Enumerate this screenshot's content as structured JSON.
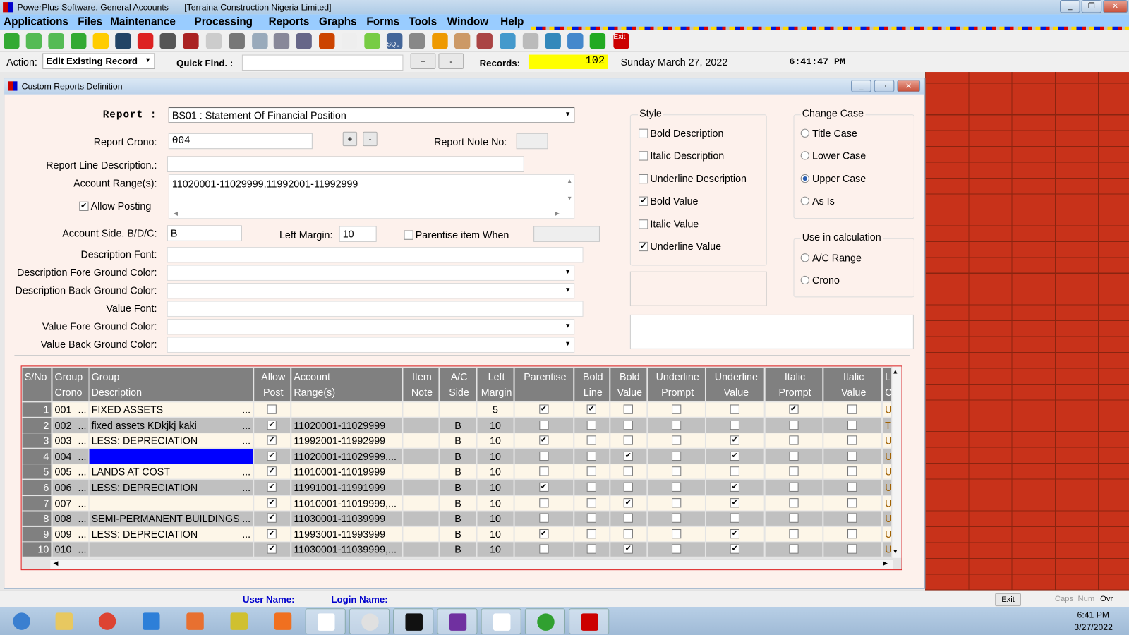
{
  "app": {
    "title": "PowerPlus-Software. General Accounts",
    "company": "[Terraina Construction Nigeria Limited]"
  },
  "menu": [
    "Applications",
    "Files",
    "Maintenance",
    "Processing",
    "Reports",
    "Graphs",
    "Forms",
    "Tools",
    "Window",
    "Help"
  ],
  "toolbar": {
    "icons": [
      "up-arrow-icon",
      "left-arrow-icon",
      "right-arrow-icon",
      "down-arrow-icon",
      "new-icon",
      "save-icon",
      "delete-icon",
      "brush-icon",
      "cancel-icon",
      "database-icon",
      "print-icon",
      "fax-icon",
      "calculator-icon",
      "calendar-icon",
      "briefcase-icon",
      "document-icon",
      "phone-icon",
      "sql-icon",
      "chip-icon",
      "settings-icon",
      "users-icon",
      "presenter-icon",
      "info-icon",
      "disk-icon",
      "globe-icon",
      "globe2-icon",
      "help-icon",
      "exit-icon"
    ],
    "exit_label": "Exit",
    "sql_label": "SQL"
  },
  "actionbar": {
    "action_label": "Action:",
    "action_value": "Edit Existing Record",
    "quickfind_label": "Quick Find. :",
    "quickfind_value": "",
    "plus": "+",
    "minus": "-",
    "records_label": "Records:",
    "records_value": "102",
    "date": "Sunday March  27,  2022",
    "time": "6:41:47 PM"
  },
  "window": {
    "title": "Custom Reports Definition"
  },
  "form": {
    "report_label": "Report :",
    "report_value": "BS01 : Statement Of Financial Position",
    "crono_label": "Report Crono:",
    "crono_value": "004",
    "plus": "+",
    "minus": "-",
    "note_label": "Report Note No:",
    "note_value": "",
    "line_desc_label": "Report Line Description.:",
    "line_desc_value": "",
    "range_label": "Account Range(s):",
    "range_value": "11020001-11029999,11992001-11992999",
    "allow_posting_label": "Allow Posting",
    "allow_posting": true,
    "side_label": "Account Side. B/D/C:",
    "side_value": "B",
    "margin_label": "Left Margin:",
    "margin_value": "10",
    "parentise_label": "Parentise item When",
    "parentise": false,
    "parentise_value": "",
    "desc_font_label": "Description Font:",
    "desc_fg_label": "Description Fore Ground Color:",
    "desc_bg_label": "Description Back Ground Color:",
    "value_font_label": "Value Font:",
    "value_fg_label": "Value Fore Ground Color:",
    "value_bg_label": "Value Back Ground Color:"
  },
  "style": {
    "title": "Style",
    "items": [
      {
        "label": "Bold Description",
        "checked": false
      },
      {
        "label": "Italic Description",
        "checked": false
      },
      {
        "label": "Underline Description",
        "checked": false
      },
      {
        "label": "Bold Value",
        "checked": true
      },
      {
        "label": "Italic Value",
        "checked": false
      },
      {
        "label": "Underline Value",
        "checked": true
      }
    ]
  },
  "change_case": {
    "title": "Change Case",
    "items": [
      {
        "label": "Title Case",
        "selected": false
      },
      {
        "label": "Lower Case",
        "selected": false
      },
      {
        "label": "Upper Case",
        "selected": true
      },
      {
        "label": "As Is",
        "selected": false
      }
    ]
  },
  "calc": {
    "title": "Use in calculation",
    "items": [
      {
        "label": "A/C Range",
        "selected": false
      },
      {
        "label": "Crono",
        "selected": false
      }
    ]
  },
  "grid": {
    "headers": [
      [
        "S/No",
        ""
      ],
      [
        "Group",
        "Crono"
      ],
      [
        "Group",
        "Description"
      ],
      [
        "Allow",
        "Post"
      ],
      [
        "Account",
        "Range(s)"
      ],
      [
        "Item",
        "Note"
      ],
      [
        "A/C",
        "Side"
      ],
      [
        "Left",
        "Margin"
      ],
      [
        "Parentise",
        ""
      ],
      [
        "Bold",
        "Line"
      ],
      [
        "Bold",
        "Value"
      ],
      [
        "Underline",
        "Prompt"
      ],
      [
        "Underline",
        "Value"
      ],
      [
        "Italic",
        "Prompt"
      ],
      [
        "Italic",
        "Value"
      ],
      [
        "L",
        "C"
      ]
    ],
    "rows": [
      {
        "sno": "1",
        "crono": "001",
        "desc": "FIXED ASSETS",
        "allow": false,
        "range": "",
        "note": "",
        "side": "",
        "margin": "5",
        "par": true,
        "bl": true,
        "bv": false,
        "up": false,
        "uv": false,
        "ip": true,
        "iv": false,
        "last": "U"
      },
      {
        "sno": "2",
        "crono": "002",
        "desc": "fixed assets  KDkjkj  kaki",
        "allow": true,
        "range": "11020001-11029999",
        "note": "",
        "side": "B",
        "margin": "10",
        "par": false,
        "bl": false,
        "bv": false,
        "up": false,
        "uv": false,
        "ip": false,
        "iv": false,
        "last": "T"
      },
      {
        "sno": "3",
        "crono": "003",
        "desc": "LESS: DEPRECIATION",
        "allow": true,
        "range": "11992001-11992999",
        "note": "",
        "side": "B",
        "margin": "10",
        "par": true,
        "bl": false,
        "bv": false,
        "up": false,
        "uv": true,
        "ip": false,
        "iv": false,
        "last": "U"
      },
      {
        "sno": "4",
        "crono": "004",
        "desc": "",
        "allow": true,
        "range": "11020001-11029999,...",
        "note": "",
        "side": "B",
        "margin": "10",
        "par": false,
        "bl": false,
        "bv": true,
        "up": false,
        "uv": true,
        "ip": false,
        "iv": false,
        "last": "U",
        "selected": true
      },
      {
        "sno": "5",
        "crono": "005",
        "desc": "LANDS AT COST",
        "allow": true,
        "range": "11010001-11019999",
        "note": "",
        "side": "B",
        "margin": "10",
        "par": false,
        "bl": false,
        "bv": false,
        "up": false,
        "uv": false,
        "ip": false,
        "iv": false,
        "last": "U"
      },
      {
        "sno": "6",
        "crono": "006",
        "desc": "LESS: DEPRECIATION",
        "allow": true,
        "range": "11991001-11991999",
        "note": "",
        "side": "B",
        "margin": "10",
        "par": true,
        "bl": false,
        "bv": false,
        "up": false,
        "uv": true,
        "ip": false,
        "iv": false,
        "last": "U"
      },
      {
        "sno": "7",
        "crono": "007",
        "desc": "",
        "allow": true,
        "range": "11010001-11019999,...",
        "note": "",
        "side": "B",
        "margin": "10",
        "par": false,
        "bl": false,
        "bv": true,
        "up": false,
        "uv": true,
        "ip": false,
        "iv": false,
        "last": "U"
      },
      {
        "sno": "8",
        "crono": "008",
        "desc": "SEMI-PERMANENT BUILDINGS",
        "allow": true,
        "range": "11030001-11039999",
        "note": "",
        "side": "B",
        "margin": "10",
        "par": false,
        "bl": false,
        "bv": false,
        "up": false,
        "uv": false,
        "ip": false,
        "iv": false,
        "last": "U"
      },
      {
        "sno": "9",
        "crono": "009",
        "desc": "LESS:  DEPRECIATION",
        "allow": true,
        "range": "11993001-11993999",
        "note": "",
        "side": "B",
        "margin": "10",
        "par": true,
        "bl": false,
        "bv": false,
        "up": false,
        "uv": true,
        "ip": false,
        "iv": false,
        "last": "U"
      },
      {
        "sno": "10",
        "crono": "010",
        "desc": "",
        "allow": true,
        "range": "11030001-11039999,...",
        "note": "",
        "side": "B",
        "margin": "10",
        "par": false,
        "bl": false,
        "bv": true,
        "up": false,
        "uv": true,
        "ip": false,
        "iv": false,
        "last": "U"
      }
    ]
  },
  "status": {
    "user_label": "User Name:",
    "login_label": "Login Name:",
    "exit": "Exit",
    "caps": "Caps",
    "num": "Num",
    "ovr": "Ovr"
  },
  "taskbar": {
    "apps": [
      "start-icon",
      "explorer-icon",
      "chrome-icon",
      "ie-icon",
      "media-player-icon",
      "zeus-icon",
      "uc-browser-icon",
      "mascot-icon",
      "opera-icon",
      "cmd-icon",
      "help-book-icon",
      "help-doc-icon",
      "glo-icon",
      "powerplus-icon"
    ],
    "time": "6:41 PM",
    "date": "3/27/2022"
  },
  "colors": {
    "selected_row": "#0000ff",
    "records_bg": "#ffff00",
    "brick": "#c8321a",
    "grid_border": "#e02020"
  }
}
